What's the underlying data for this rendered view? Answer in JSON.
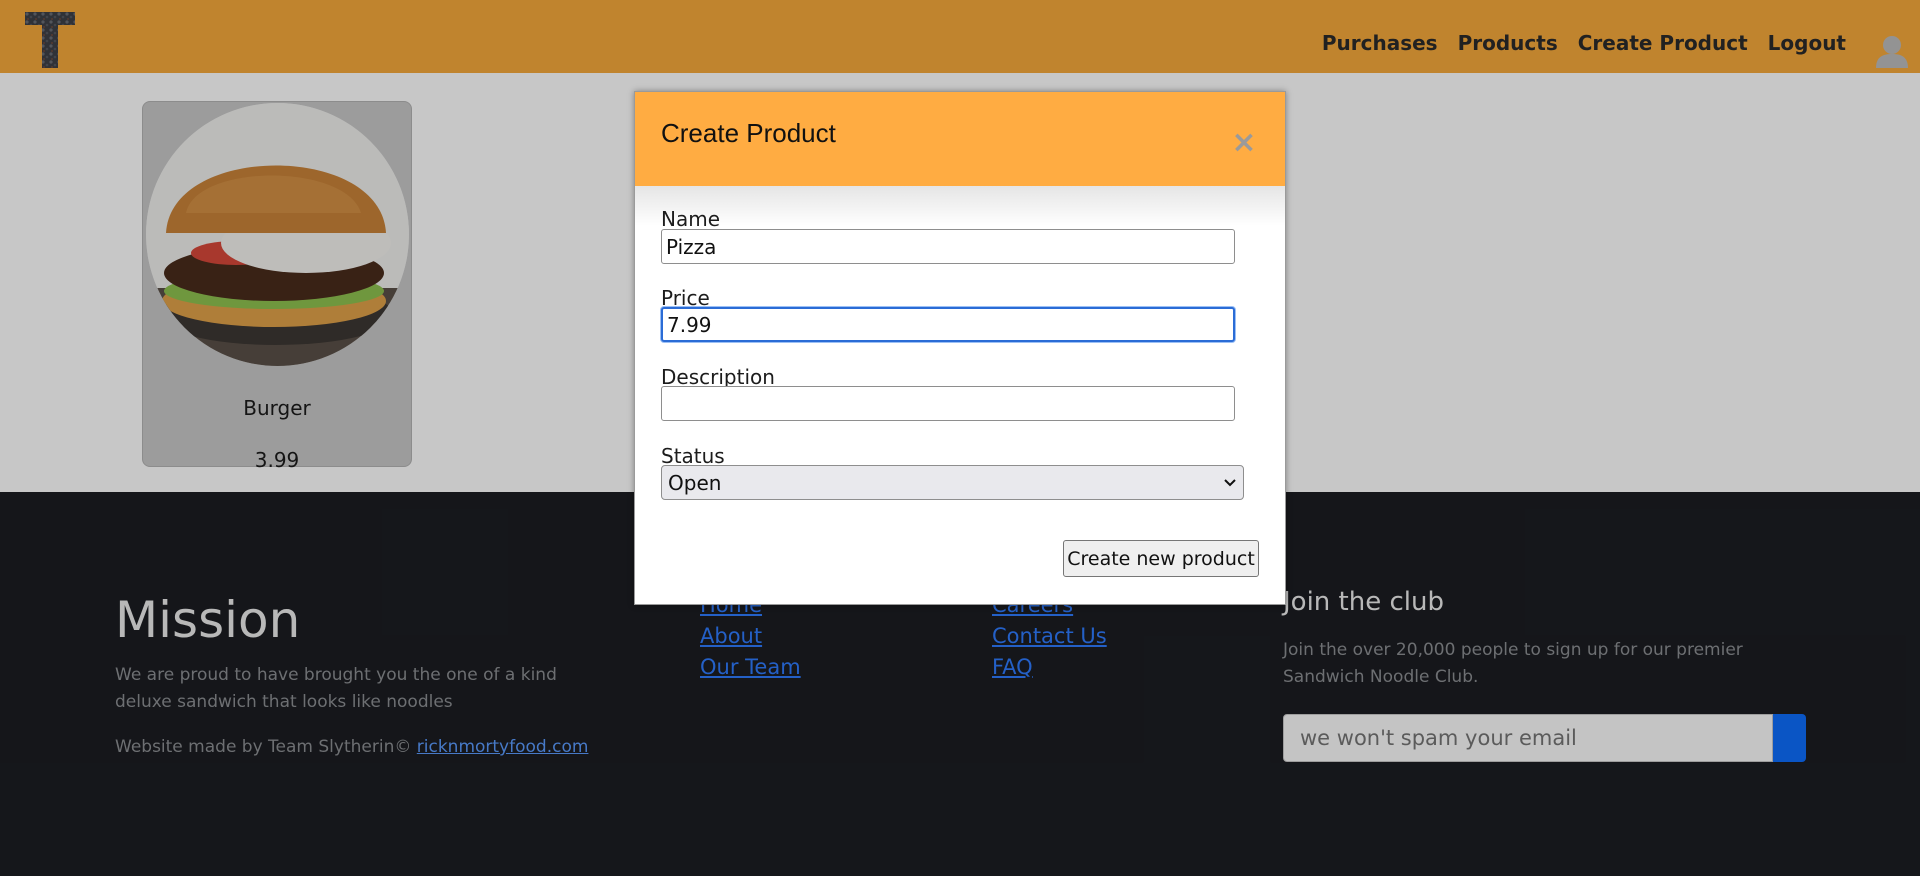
{
  "header": {
    "logo_letter": "T",
    "nav": [
      "Purchases",
      "Products",
      "Create Product",
      "Logout"
    ],
    "brand_color": "#f7a93c"
  },
  "products": [
    {
      "name": "Burger",
      "price": "3.99"
    }
  ],
  "footer": {
    "mission": {
      "title": "Mission",
      "text": "We are proud to have brought you the one of a kind deluxe sandwich that looks like noodles",
      "credit_prefix": "Website made by Team Slytherin© ",
      "credit_link": "ricknmortyfood.com"
    },
    "links_col1": [
      "Home",
      "About",
      "Our Team"
    ],
    "links_col2": [
      "Careers",
      "Contact Us",
      "FAQ"
    ],
    "club": {
      "title": "Join the club",
      "text": "Join the over 20,000 people to sign up for our premier Sandwich Noodle Club.",
      "placeholder": "we won't spam your email",
      "button_color": "#0d6efd"
    }
  },
  "modal": {
    "title": "Create Product",
    "close_glyph": "×",
    "name_label": "Name",
    "name_value": "Pizza",
    "price_label": "Price",
    "price_value": "7.99",
    "description_label": "Description",
    "description_value": "",
    "status_label": "Status",
    "status_value": "Open",
    "submit_label": "Create new product",
    "header_color": "#ffac42"
  }
}
